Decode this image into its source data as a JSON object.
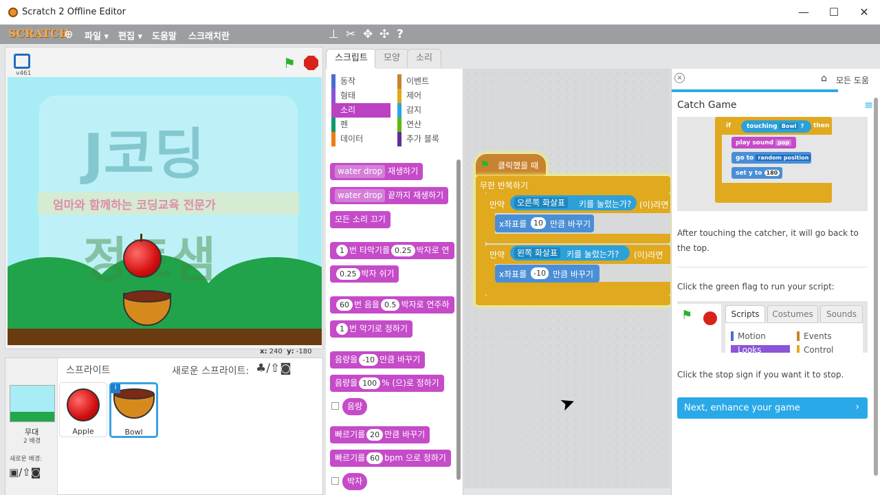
{
  "window": {
    "title": "Scratch 2 Offline Editor",
    "min": "—",
    "max": "☐",
    "close": "✕"
  },
  "menubar": {
    "logo": "SCRATCH",
    "file": "파일 ▾",
    "edit": "편집 ▾",
    "help": "도움말",
    "about": "스크래치란"
  },
  "stage": {
    "version": "v461",
    "coords_x_label": "x:",
    "coords_x": "240",
    "coords_y_label": "y:",
    "coords_y": "-180",
    "backdrop_title": "J코딩",
    "backdrop_sub": "엄마와 함께하는 코딩교육 전문가",
    "backdrop_bottom": "정토샘"
  },
  "sprites": {
    "header": "스프라이트",
    "new_sprite": "새로운 스프라이트:",
    "stage_label": "무대",
    "stage_count": "2 배경",
    "new_backdrop": "새로운 배경:",
    "items": [
      {
        "name": "Apple"
      },
      {
        "name": "Bowl"
      }
    ]
  },
  "tabs": [
    "스크립트",
    "모양",
    "소리"
  ],
  "categories": {
    "left": [
      {
        "label": "동작",
        "color": "#4a6cd4"
      },
      {
        "label": "형태",
        "color": "#8a55d7"
      },
      {
        "label": "소리",
        "color": "#bb42c3"
      },
      {
        "label": "펜",
        "color": "#0e9a6c"
      },
      {
        "label": "데이터",
        "color": "#ee7d16"
      }
    ],
    "right": [
      {
        "label": "이벤트",
        "color": "#c88330"
      },
      {
        "label": "제어",
        "color": "#e1a91a"
      },
      {
        "label": "감지",
        "color": "#2ca5e2"
      },
      {
        "label": "연산",
        "color": "#5cb712"
      },
      {
        "label": "추가 블록",
        "color": "#632d99"
      }
    ]
  },
  "palette": {
    "b1_dd": "water drop",
    "b1": "재생하기",
    "b2_dd": "water drop",
    "b2": "끝까지 재생하기",
    "b3": "모든 소리 끄기",
    "b4_n": "1",
    "b4a": "번 타악기를",
    "b4_v": "0.25",
    "b4b": "박자로 연",
    "b5_v": "0.25",
    "b5": "박자 쉬기",
    "b6_n": "60",
    "b6a": "번 음을",
    "b6_v": "0.5",
    "b6b": "박자로 연주하",
    "b7_n": "1",
    "b7": "번 악기로 정하기",
    "b8a": "음량을",
    "b8_v": "-10",
    "b8b": "만큼 바꾸기",
    "b9a": "음량을",
    "b9_v": "100",
    "b9b": "% (으)로 정하기",
    "b10": "음량",
    "b11a": "빠르기를",
    "b11_v": "20",
    "b11b": "만큼 바꾸기",
    "b12a": "빠르기를",
    "b12_v": "60",
    "b12b": "bpm 으로 정하기",
    "b13": "박자"
  },
  "script": {
    "hat": "클릭했을 때",
    "forever": "무한 반복하기",
    "if1": "만약",
    "key1": "오른쪽 화살표",
    "pressed1": "키를 눌렀는가?",
    "then1": "(이)라면",
    "cx1a": "x좌표를",
    "cx1_v": "10",
    "cx1b": "만큼 바꾸기",
    "if2": "만약",
    "key2": "왼쪽 화살표",
    "pressed2": "키를 눌렀는가?",
    "then2": "(이)라면",
    "cx2a": "x좌표를",
    "cx2_v": "-10",
    "cx2b": "만큼 바꾸기"
  },
  "help": {
    "all_help": "모든 도움",
    "title": "Catch Game",
    "img_if": "if",
    "img_touching": "touching",
    "img_bowl": "Bowl",
    "img_q": "?",
    "img_then": "then",
    "img_play": "play sound",
    "img_pop": "pop",
    "img_goto": "go to",
    "img_random": "random position",
    "img_sety": "set y to",
    "img_180": "180",
    "p1": "After touching the catcher, it will go back to the top.",
    "p2": "Click the green flag to run your script:",
    "mini_tabs": [
      "Scripts",
      "Costumes",
      "Sounds"
    ],
    "mini_cats": [
      "Motion",
      "Events",
      "Looks",
      "Control"
    ],
    "p3": "Click the stop sign if you want it to stop.",
    "next": "Next, enhance your game"
  }
}
